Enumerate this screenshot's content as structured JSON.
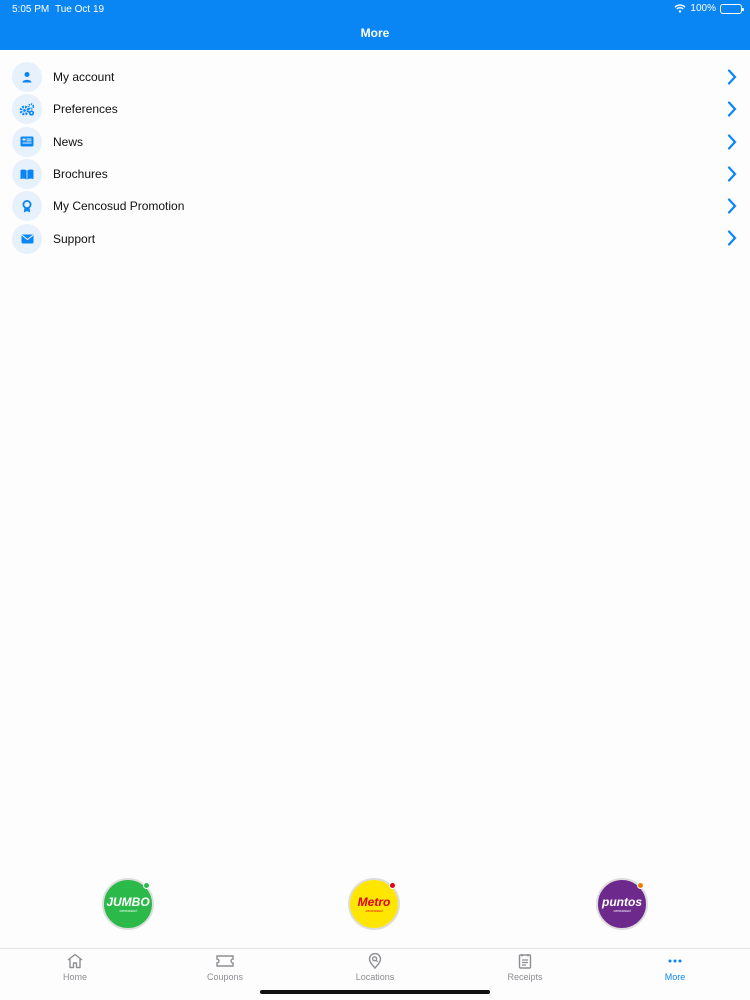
{
  "status": {
    "time": "5:05 PM",
    "date": "Tue Oct 19",
    "battery": "100%"
  },
  "nav": {
    "title": "More"
  },
  "menu": {
    "items": [
      {
        "label": "My account",
        "icon": "person-icon"
      },
      {
        "label": "Preferences",
        "icon": "gears-icon"
      },
      {
        "label": "News",
        "icon": "newspaper-icon"
      },
      {
        "label": "Brochures",
        "icon": "book-icon"
      },
      {
        "label": "My Cencosud Promotion",
        "icon": "award-icon"
      },
      {
        "label": "Support",
        "icon": "envelope-icon"
      }
    ]
  },
  "brands": [
    {
      "name": "JUMBO",
      "sub": "cencosud",
      "color": "#2bb94a",
      "text_color": "#ffffff",
      "dot": "#2bb94a"
    },
    {
      "name": "Metro",
      "sub": "cencosud",
      "color": "#ffe600",
      "text_color": "#e2001a",
      "dot": "#e2001a"
    },
    {
      "name": "puntos",
      "sub": "cencosud",
      "color": "#6d2a8c",
      "text_color": "#ffffff",
      "dot": "#f07d00"
    }
  ],
  "tabs": [
    {
      "label": "Home",
      "icon": "house-icon"
    },
    {
      "label": "Coupons",
      "icon": "ticket-icon"
    },
    {
      "label": "Locations",
      "icon": "map-pin-search-icon"
    },
    {
      "label": "Receipts",
      "icon": "receipt-icon"
    },
    {
      "label": "More",
      "icon": "ellipsis-icon",
      "active": true
    }
  ],
  "colors": {
    "accent": "#0a86f4",
    "icon_bg": "#e7f1fb"
  }
}
